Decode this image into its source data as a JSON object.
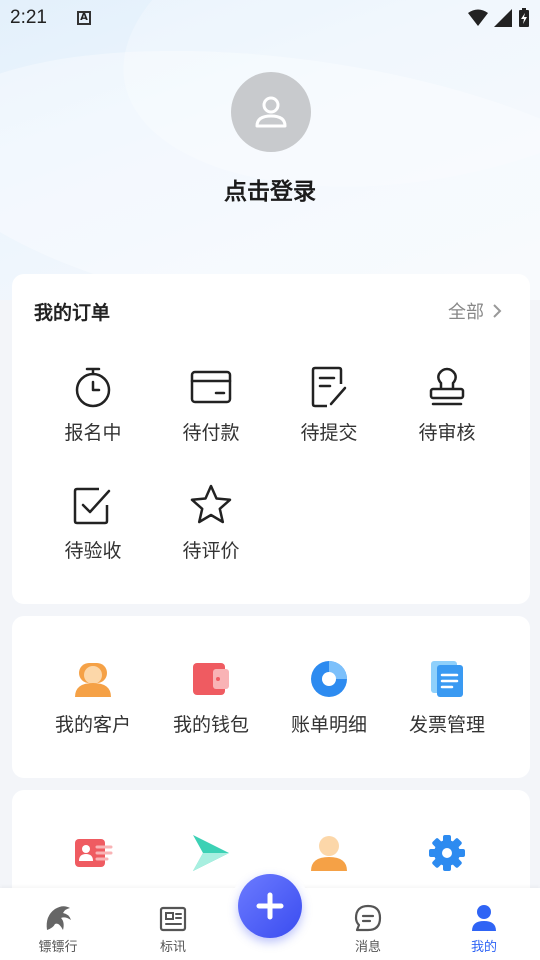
{
  "status_bar": {
    "time": "2:21",
    "badge": "A"
  },
  "profile": {
    "login_text": "点击登录"
  },
  "orders": {
    "title": "我的订单",
    "all_label": "全部",
    "items": [
      {
        "label": "报名中",
        "icon": "timer-icon"
      },
      {
        "label": "待付款",
        "icon": "wallet-icon"
      },
      {
        "label": "待提交",
        "icon": "document-edit-icon"
      },
      {
        "label": "待审核",
        "icon": "stamp-icon"
      },
      {
        "label": "待验收",
        "icon": "checkbox-icon"
      },
      {
        "label": "待评价",
        "icon": "star-icon"
      }
    ]
  },
  "tools": {
    "items": [
      {
        "label": "我的客户",
        "icon": "customer-icon"
      },
      {
        "label": "我的钱包",
        "icon": "wallet-color-icon"
      },
      {
        "label": "账单明细",
        "icon": "pie-chart-icon"
      },
      {
        "label": "发票管理",
        "icon": "invoice-icon"
      }
    ]
  },
  "more": {
    "items": [
      {
        "icon": "id-card-icon"
      },
      {
        "icon": "play-arrow-icon"
      },
      {
        "icon": "person-icon"
      },
      {
        "icon": "settings-icon"
      }
    ]
  },
  "tabbar": {
    "items": [
      {
        "label": "镖镖行",
        "icon": "brand-horse-icon"
      },
      {
        "label": "标讯",
        "icon": "news-icon"
      },
      {
        "label": "消息",
        "icon": "message-icon"
      },
      {
        "label": "我的",
        "icon": "user-icon",
        "active": true
      }
    ],
    "fab_icon": "plus-icon"
  },
  "colors": {
    "accent": "#2f64f5",
    "fab": "#4a5cf5",
    "avatar_bg": "#c8cacd"
  }
}
